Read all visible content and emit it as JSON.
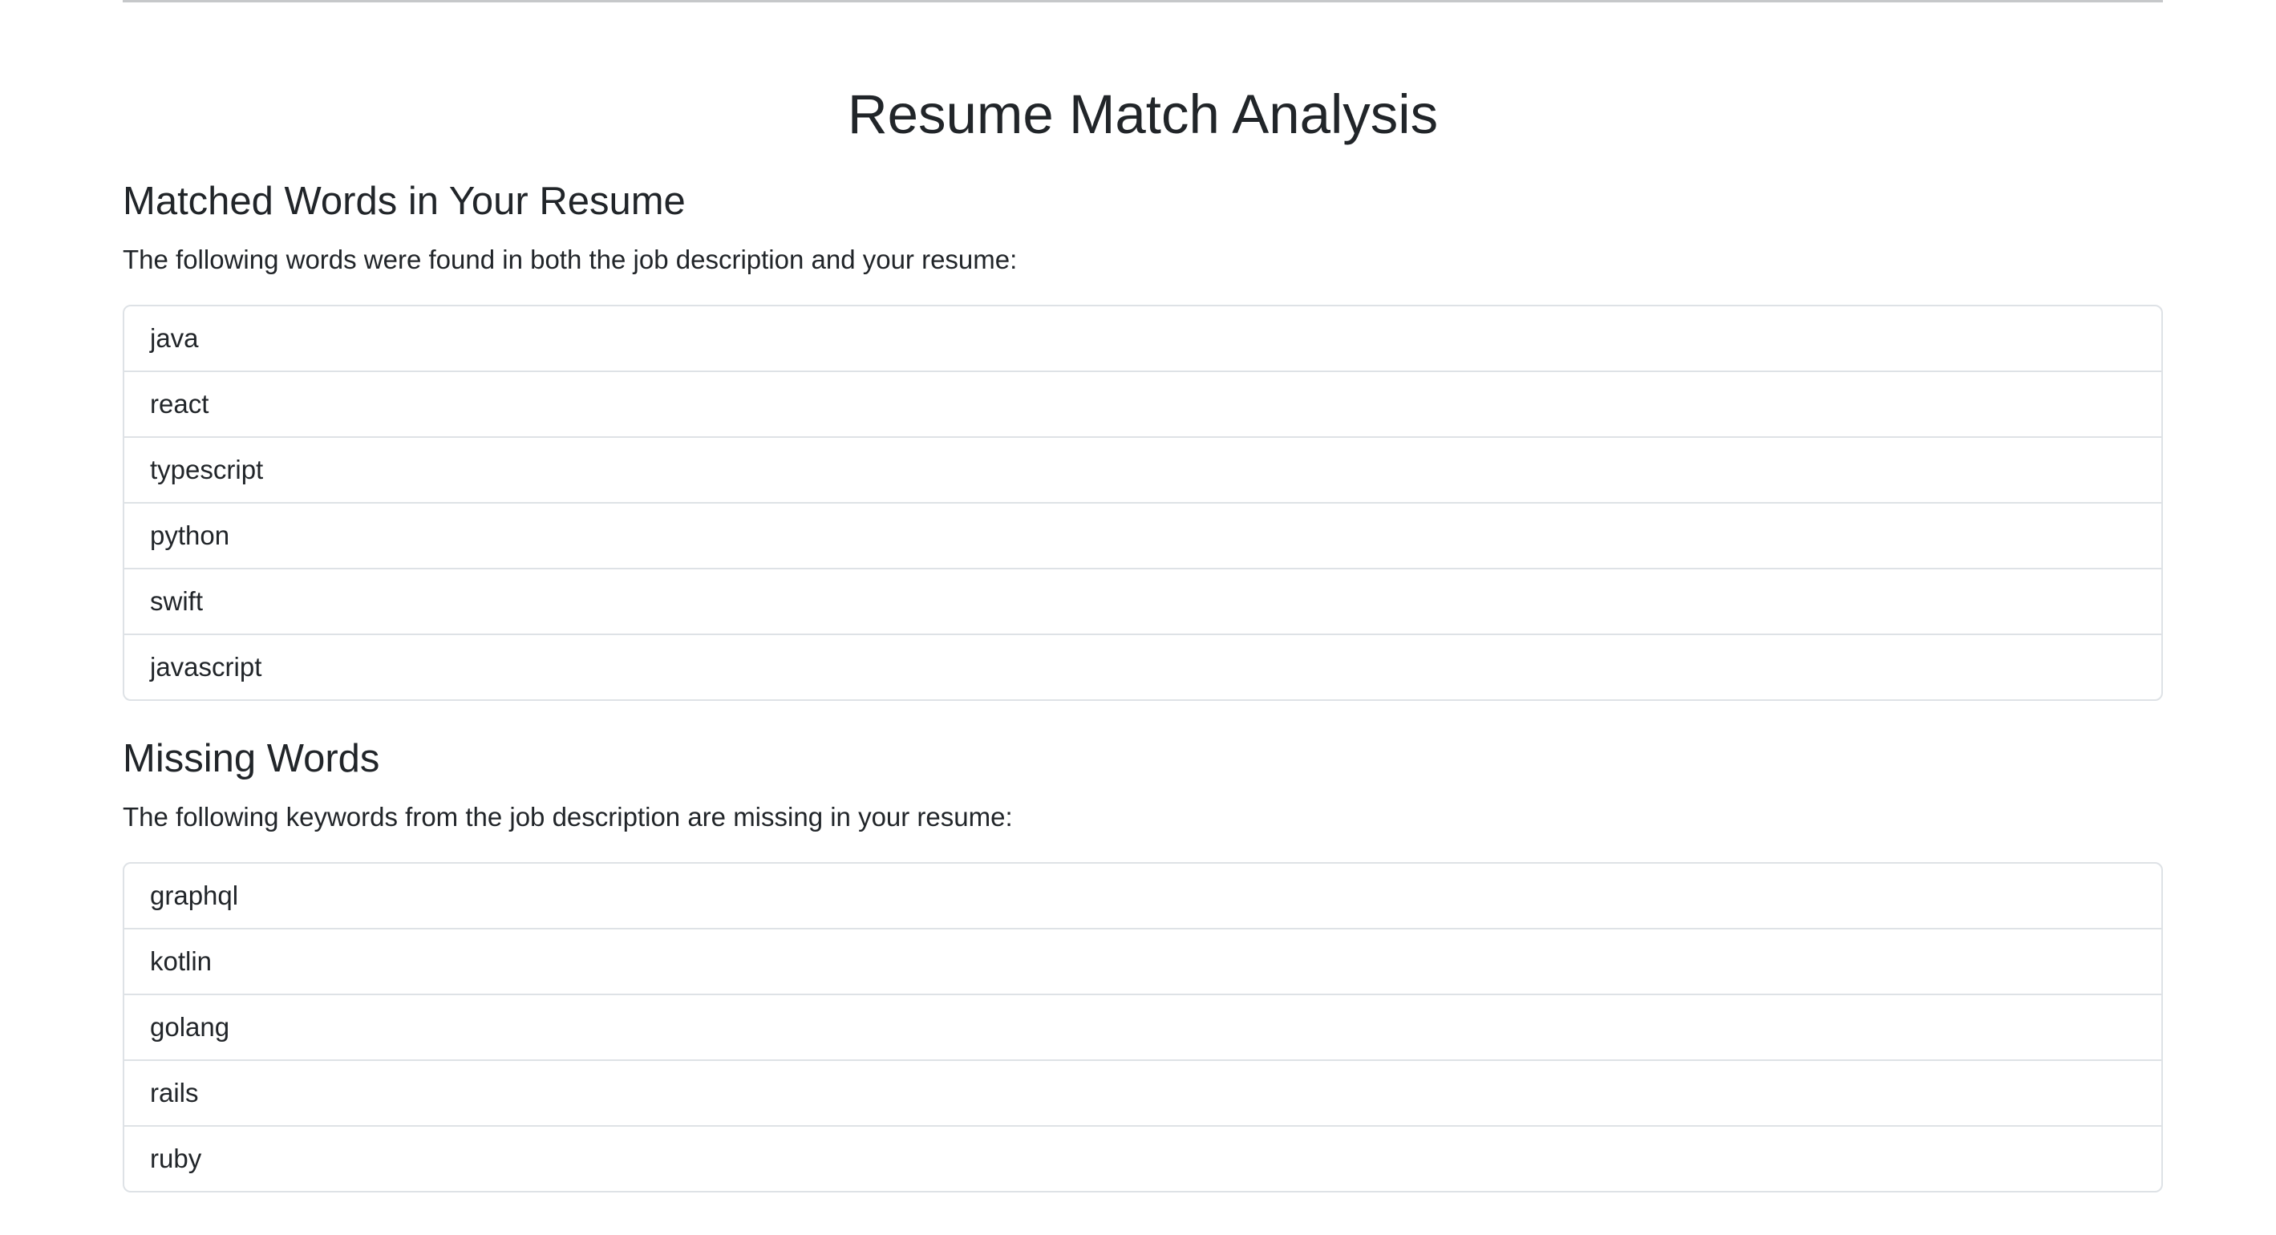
{
  "page": {
    "title": "Resume Match Analysis"
  },
  "matched": {
    "heading": "Matched Words in Your Resume",
    "description": "The following words were found in both the job description and your resume:",
    "items": [
      "java",
      "react",
      "typescript",
      "python",
      "swift",
      "javascript"
    ]
  },
  "missing": {
    "heading": "Missing Words",
    "description": "The following keywords from the job description are missing in your resume:",
    "items": [
      "graphql",
      "kotlin",
      "golang",
      "rails",
      "ruby"
    ]
  },
  "colors": {
    "text": "#212529",
    "border": "#dee2e6",
    "rule": "#c6c8ca",
    "background": "#ffffff"
  }
}
